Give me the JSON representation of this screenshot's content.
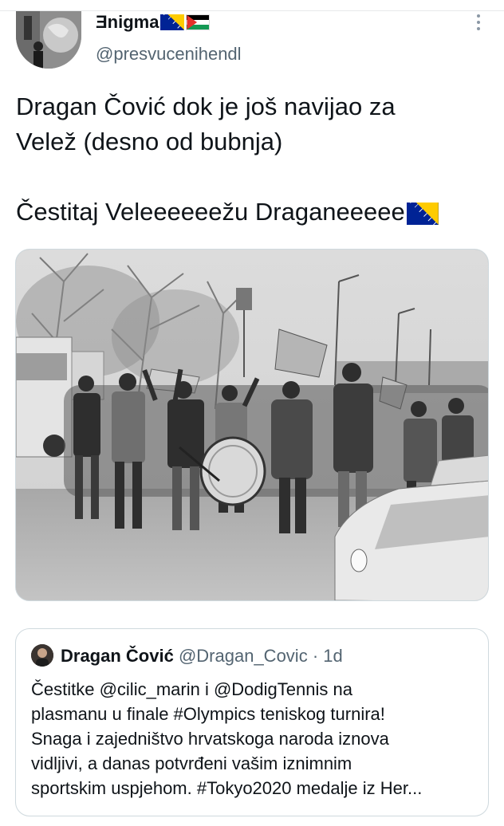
{
  "tweet": {
    "author": {
      "display_name": "Ǝnigma",
      "handle": "@presvucenihendl",
      "name_flags": [
        "bosnia-flag",
        "palestine-flag"
      ]
    },
    "text_lines": [
      "Dragan Čović dok je još navijao za",
      "Velež (desno od bubnja)"
    ],
    "text_line_3": "Čestitaj Veleeeeeežu Draganeeeee",
    "photo": {
      "type": "black-and-white photograph",
      "subject": "fans marching with a bass drum"
    }
  },
  "quoted_tweet": {
    "name": "Dragan Čović",
    "handle": "@Dragan_Covic",
    "separator": "·",
    "time": "1d",
    "text_lines": [
      "Čestitke @cilic_marin i @DodigTennis na",
      "plasmanu u finale #Olympics teniskog turnira!",
      "Snaga i zajedništvo hrvatskoga naroda iznova",
      "vidljivi, a danas potvrđeni vašim iznimnim",
      "sportskim uspjehom. #Tokyo2020 medalje iz Her..."
    ]
  },
  "icons": {
    "more": "more-vertical-icon"
  },
  "colors": {
    "text": "#0f1419",
    "secondary": "#536471",
    "border": "#cfd9de",
    "bosnia_blue": "#002395",
    "bosnia_yellow": "#fecb00"
  }
}
